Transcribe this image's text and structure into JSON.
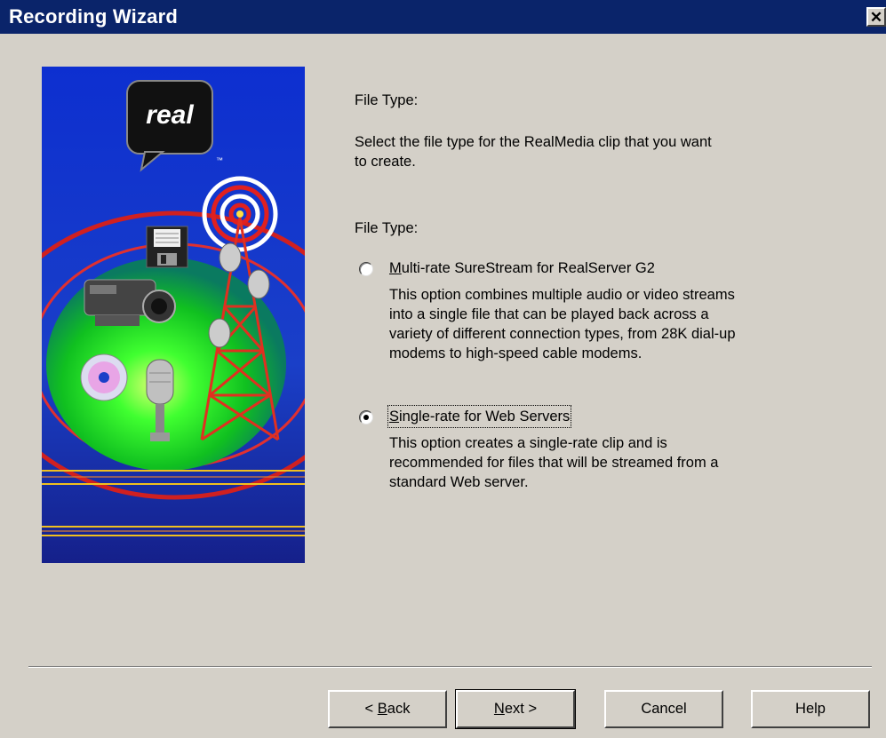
{
  "window": {
    "title": "Recording Wizard",
    "close_label": "✕"
  },
  "banner": {
    "logo_text": "real",
    "trademark": "™"
  },
  "page": {
    "heading": "File Type:",
    "description_line1": "Select the file type for the RealMedia clip that you want",
    "description_line2": "to create.",
    "group_label": "File Type:"
  },
  "options": [
    {
      "label_prefix": "",
      "label_mnemonic": "M",
      "label_rest": "ulti-rate SureStream for RealServer G2",
      "selected": false,
      "desc": [
        "This option combines multiple audio or video streams",
        "into a single file that can be played back across a",
        "variety of different connection types, from 28K dial-up",
        "modems to high-speed cable modems."
      ]
    },
    {
      "label_prefix": "",
      "label_mnemonic": "S",
      "label_rest": "ingle-rate for Web Servers",
      "selected": true,
      "desc": [
        "This option creates a single-rate clip and is",
        "recommended for files that will be streamed from a",
        "standard Web server."
      ]
    }
  ],
  "buttons": {
    "back_prefix": "< ",
    "back_mnemonic": "B",
    "back_rest": "ack",
    "next_mnemonic": "N",
    "next_rest": "ext >",
    "cancel": "Cancel",
    "help": "Help"
  },
  "colors": {
    "titlebar": "#0a246a",
    "face": "#d4d0c8",
    "banner_blue": "#1a3fc8",
    "banner_green": "#22ff22"
  }
}
